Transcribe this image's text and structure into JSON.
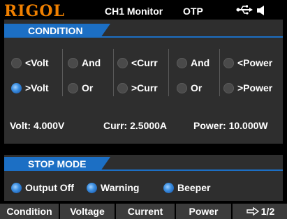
{
  "header": {
    "brand": "RIGOL",
    "title": "CH1 Monitor",
    "mode": "OTP",
    "usb_icon": "usb-icon",
    "speaker_icon": "speaker-icon"
  },
  "condition": {
    "label": "CONDITION",
    "row1": [
      {
        "label": "<Volt",
        "selected": false
      },
      {
        "label": "And",
        "selected": false
      },
      {
        "label": "<Curr",
        "selected": false
      },
      {
        "label": "And",
        "selected": false
      },
      {
        "label": "<Power",
        "selected": false
      }
    ],
    "row2": [
      {
        "label": ">Volt",
        "selected": true
      },
      {
        "label": "Or",
        "selected": false
      },
      {
        "label": ">Curr",
        "selected": false
      },
      {
        "label": "Or",
        "selected": false
      },
      {
        "label": ">Power",
        "selected": false
      }
    ]
  },
  "readouts": {
    "volt": "Volt:  4.000V",
    "curr": "Curr:  2.5000A",
    "power": "Power: 10.000W"
  },
  "stop_mode": {
    "label": "STOP MODE",
    "options": [
      {
        "label": "Output Off",
        "selected": true
      },
      {
        "label": "Warning",
        "selected": true
      },
      {
        "label": "Beeper",
        "selected": true
      }
    ]
  },
  "softkeys": [
    "Condition",
    "Voltage",
    "Current",
    "Power",
    "1/2"
  ],
  "colors": {
    "accent": "#1c6fc4",
    "brand": "#f08000",
    "panel": "#2e2e2e"
  }
}
